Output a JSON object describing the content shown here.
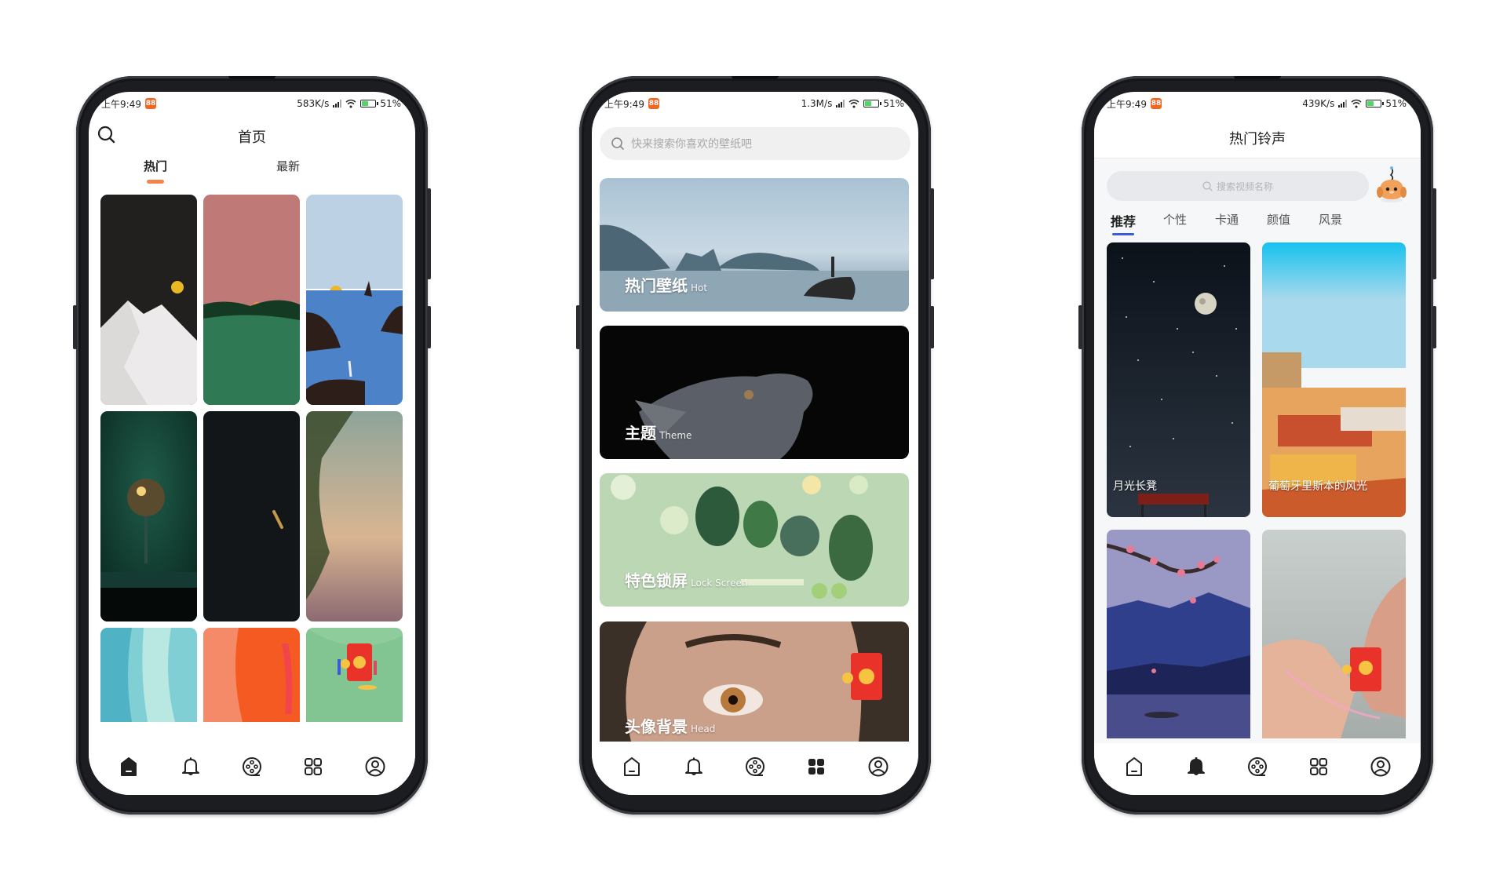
{
  "status_bar": {
    "time": "上午9:49",
    "app_badge": "88",
    "battery": "51%",
    "battery_level": 0.51
  },
  "phones": [
    {
      "network_speed": "583K/s",
      "header": {
        "title": "首页"
      },
      "tabs": [
        {
          "label": "热门",
          "active": true
        },
        {
          "label": "最新",
          "active": false
        }
      ],
      "wallpapers": [
        {
          "name": "snowy-mountain-moon"
        },
        {
          "name": "pink-sky-green-hill"
        },
        {
          "name": "sea-rocks-sunset"
        },
        {
          "name": "lamp-green-room"
        },
        {
          "name": "dark-koi"
        },
        {
          "name": "palm-sunset"
        },
        {
          "name": "blue-watercolor"
        },
        {
          "name": "orange-watercolor"
        },
        {
          "name": "red-envelope-promo"
        }
      ],
      "bottom_nav_active": "home"
    },
    {
      "network_speed": "1.3M/s",
      "search": {
        "placeholder": "快来搜索你喜欢的壁纸吧"
      },
      "categories": [
        {
          "title": "热门壁纸",
          "subtitle": "Hot"
        },
        {
          "title": "主题",
          "subtitle": "Theme"
        },
        {
          "title": "特色锁屏",
          "subtitle": "Lock Screen"
        },
        {
          "title": "头像背景",
          "subtitle": "Head"
        }
      ],
      "bottom_nav_active": "categories"
    },
    {
      "network_speed": "439K/s",
      "header": {
        "title": "热门铃声"
      },
      "search": {
        "placeholder": "搜索视频名称"
      },
      "tabs": [
        {
          "label": "推荐",
          "active": true
        },
        {
          "label": "个性",
          "active": false
        },
        {
          "label": "卡通",
          "active": false
        },
        {
          "label": "颜值",
          "active": false
        },
        {
          "label": "风景",
          "active": false
        }
      ],
      "videos": [
        {
          "caption": "月光长凳"
        },
        {
          "caption": "葡萄牙里斯本的风光"
        },
        {
          "caption": ""
        },
        {
          "caption": ""
        }
      ],
      "bottom_nav_active": "ringtones"
    }
  ],
  "bottom_nav": [
    {
      "id": "home",
      "icon": "home-icon"
    },
    {
      "id": "ringtones",
      "icon": "bell-icon"
    },
    {
      "id": "video",
      "icon": "film-reel-icon"
    },
    {
      "id": "categories",
      "icon": "grid-icon"
    },
    {
      "id": "profile",
      "icon": "user-icon"
    }
  ],
  "colors": {
    "accent_orange": "#f6844a",
    "accent_blue": "#3d5bd9",
    "app_badge": "#f26522"
  }
}
